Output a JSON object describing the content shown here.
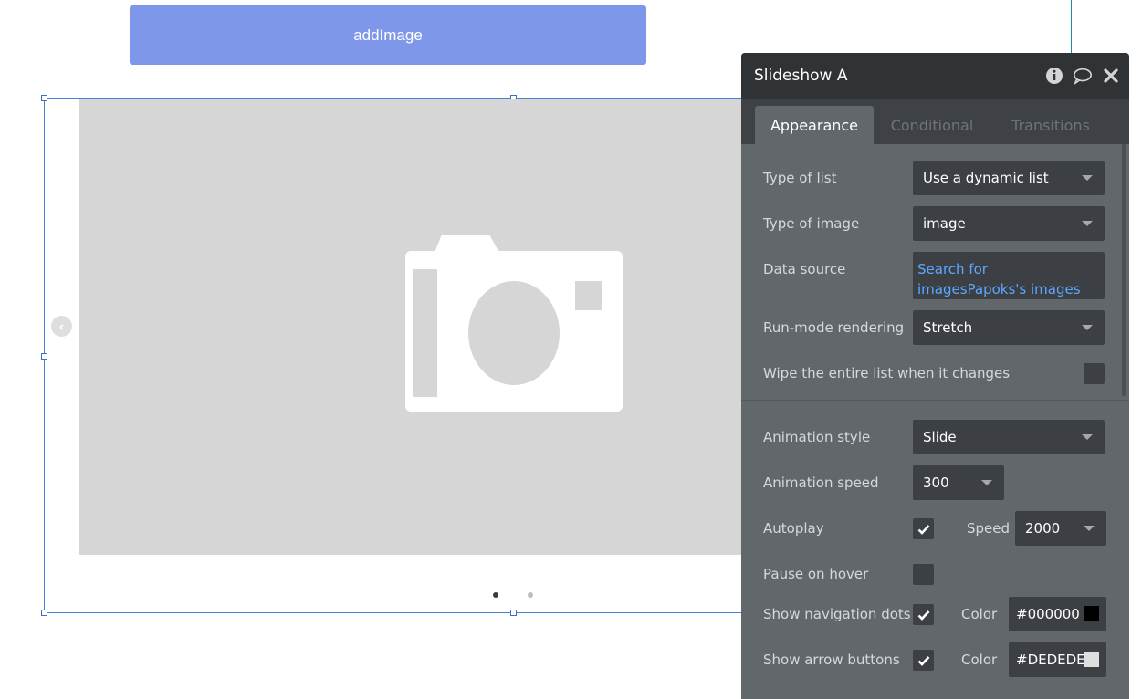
{
  "canvas": {
    "add_button_label": "addImage",
    "dots": {
      "active_color": "#000000",
      "inactive_color": "#bdbdbd",
      "count": 2,
      "active_index": 0
    }
  },
  "panel": {
    "title": "Slideshow A",
    "header_icons": [
      "info-icon",
      "comment-icon",
      "close-icon"
    ],
    "tabs": [
      {
        "label": "Appearance",
        "active": true
      },
      {
        "label": "Conditional",
        "active": false
      },
      {
        "label": "Transitions",
        "active": false
      }
    ],
    "fields": {
      "type_of_list": {
        "label": "Type of list",
        "value": "Use a dynamic list"
      },
      "type_of_image": {
        "label": "Type of image",
        "value": "image"
      },
      "data_source": {
        "label": "Data source",
        "value": "Search for imagesPapoks's images"
      },
      "run_mode": {
        "label": "Run-mode rendering",
        "value": "Stretch"
      },
      "wipe_list": {
        "label": "Wipe the entire list when it changes",
        "checked": false
      },
      "animation_style": {
        "label": "Animation style",
        "value": "Slide"
      },
      "animation_speed": {
        "label": "Animation speed",
        "value": "300"
      },
      "autoplay": {
        "label": "Autoplay",
        "checked": true,
        "speed_label": "Speed",
        "speed_value": "2000"
      },
      "pause_on_hover": {
        "label": "Pause on hover",
        "checked": false
      },
      "show_nav_dots": {
        "label": "Show navigation dots",
        "checked": true,
        "color_label": "Color",
        "color_value": "#000000",
        "swatch": "#000000"
      },
      "show_arrows": {
        "label": "Show arrow buttons",
        "checked": true,
        "color_label": "Color",
        "color_value": "#DEDEDE",
        "swatch": "#DEDEDE"
      }
    }
  }
}
